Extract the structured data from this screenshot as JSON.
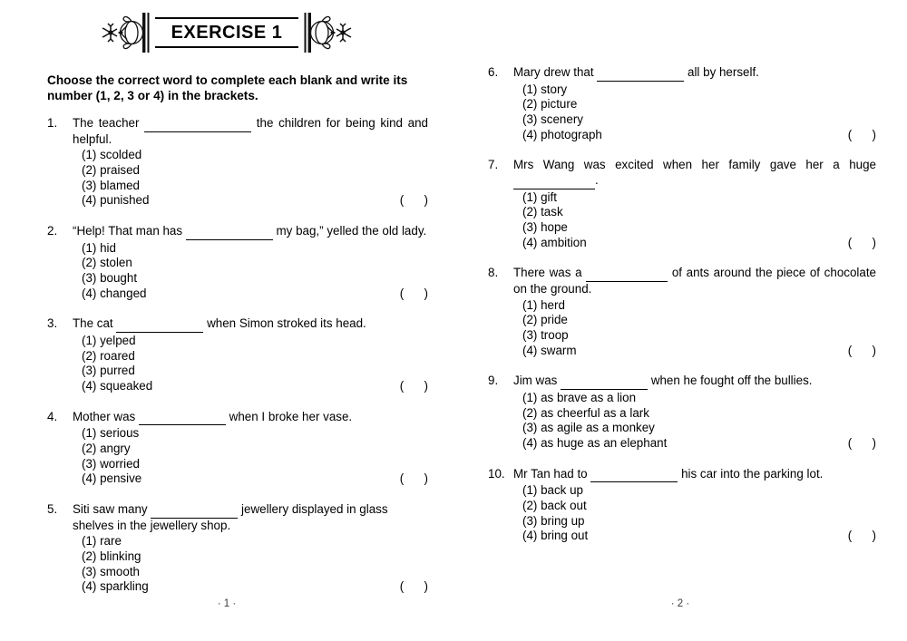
{
  "header": {
    "title": "EXERCISE 1",
    "left_ornament": "floral-knot-ornament",
    "right_ornament": "floral-knot-ornament"
  },
  "instructions": "Choose the correct word to complete each blank and write its number (1, 2, 3 or 4) in the brackets.",
  "brackets_label": "(      )",
  "questions": [
    {
      "number": "1.",
      "stem_before": "The teacher",
      "stem_after": "the children for being kind and helpful.",
      "justify": true,
      "blank_width": 118,
      "options": [
        "(1) scolded",
        "(2) praised",
        "(3) blamed",
        "(4) punished"
      ]
    },
    {
      "number": "2.",
      "stem_before": "“Help! That man has",
      "stem_after": "my bag,” yelled the old lady.",
      "justify": false,
      "blank_width": 96,
      "options": [
        "(1) hid",
        "(2) stolen",
        "(3) bought",
        "(4) changed"
      ]
    },
    {
      "number": "3.",
      "stem_before": "The cat",
      "stem_after": "when Simon stroked its head.",
      "justify": false,
      "blank_width": 96,
      "options": [
        "(1) yelped",
        "(2) roared",
        "(3) purred",
        "(4) squeaked"
      ]
    },
    {
      "number": "4.",
      "stem_before": "Mother was",
      "stem_after": "when I broke her vase.",
      "justify": false,
      "blank_width": 96,
      "options": [
        "(1) serious",
        "(2) angry",
        "(3) worried",
        "(4) pensive"
      ]
    },
    {
      "number": "5.",
      "stem_before": "Siti saw many",
      "stem_after": "jewellery displayed in glass shelves in the jewellery shop.",
      "justify": false,
      "blank_width": 96,
      "options": [
        "(1) rare",
        "(2) blinking",
        "(3) smooth",
        "(4) sparkling"
      ]
    },
    {
      "number": "6.",
      "stem_before": "Mary drew that",
      "stem_after": "all by herself.",
      "justify": false,
      "blank_width": 96,
      "options": [
        "(1) story",
        "(2) picture",
        "(3) scenery",
        "(4) photograph"
      ]
    },
    {
      "number": "7.",
      "stem_before": "Mrs Wang was excited when her family gave her a huge",
      "stem_after": ".",
      "justify": true,
      "blank_width": 90,
      "options": [
        "(1) gift",
        "(2) task",
        "(3) hope",
        "(4) ambition"
      ]
    },
    {
      "number": "8.",
      "stem_before": "There was a",
      "stem_after": "of ants around the piece of chocolate on the ground.",
      "justify": true,
      "blank_width": 90,
      "options": [
        "(1) herd",
        "(2) pride",
        "(3) troop",
        "(4) swarm"
      ]
    },
    {
      "number": "9.",
      "stem_before": "Jim was",
      "stem_after": "when he fought off the bullies.",
      "justify": false,
      "blank_width": 96,
      "options": [
        "(1) as brave as a lion",
        "(2) as cheerful as a lark",
        "(3) as agile as a monkey",
        "(4) as huge as an elephant"
      ]
    },
    {
      "number": "10.",
      "stem_before": "Mr Tan had to",
      "stem_after": "his car into the parking lot.",
      "justify": false,
      "blank_width": 96,
      "options": [
        "(1) back up",
        "(2) back out",
        "(3) bring up",
        "(4) bring out"
      ]
    }
  ],
  "footers": {
    "left": "· 1 ·",
    "right": "· 2 ·"
  }
}
